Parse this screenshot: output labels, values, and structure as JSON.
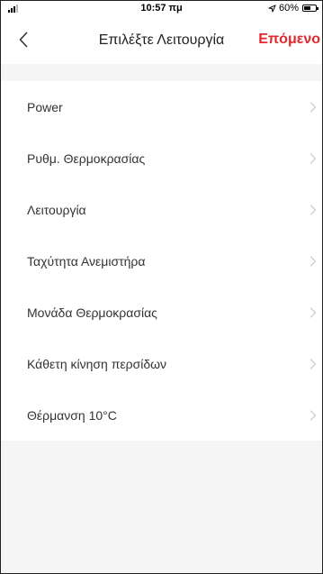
{
  "status_bar": {
    "time": "10:57 πμ",
    "battery_percent": "60%",
    "battery_level": 0.6,
    "icons": [
      "signal-icon",
      "location-arrow-icon",
      "battery-icon"
    ]
  },
  "nav": {
    "title": "Επιλέξτε Λειτουργία",
    "next_label": "Επόμενο",
    "back_icon": "chevron-left-icon"
  },
  "colors": {
    "accent": "#e3262e",
    "background": "#f5f5f5",
    "list_background": "#ffffff",
    "chevron": "#c7c7cc"
  },
  "functions": [
    {
      "label": "Power"
    },
    {
      "label": "Ρυθμ. Θερμοκρασίας"
    },
    {
      "label": "Λειτουργία"
    },
    {
      "label": "Ταχύτητα Ανεμιστήρα"
    },
    {
      "label": "Μονάδα Θερμοκρασίας"
    },
    {
      "label": "Κάθετη κίνηση περσίδων"
    },
    {
      "label": "Θέρμανση 10°C"
    }
  ]
}
